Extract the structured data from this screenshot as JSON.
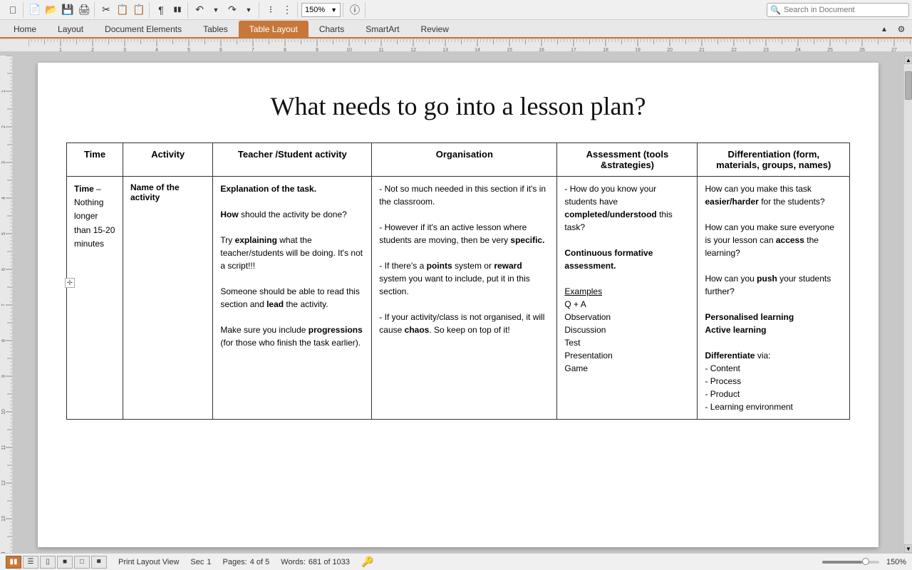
{
  "toolbar": {
    "zoom": "150%",
    "search_placeholder": "Search in Document"
  },
  "tabs": [
    {
      "id": "home",
      "label": "Home",
      "active": false
    },
    {
      "id": "layout",
      "label": "Layout",
      "active": false
    },
    {
      "id": "document-elements",
      "label": "Document Elements",
      "active": false
    },
    {
      "id": "tables",
      "label": "Tables",
      "active": false
    },
    {
      "id": "table-layout",
      "label": "Table Layout",
      "active": true
    },
    {
      "id": "charts",
      "label": "Charts",
      "active": false
    },
    {
      "id": "smartart",
      "label": "SmartArt",
      "active": false
    },
    {
      "id": "review",
      "label": "Review",
      "active": false
    }
  ],
  "document": {
    "title": "What needs to go into a lesson plan?",
    "table": {
      "headers": [
        {
          "id": "time",
          "label": "Time"
        },
        {
          "id": "activity",
          "label": "Activity"
        },
        {
          "id": "teacher",
          "label": "Teacher /Student activity"
        },
        {
          "id": "organisation",
          "label": "Organisation"
        },
        {
          "id": "assessment",
          "label": "Assessment (tools &strategies)"
        },
        {
          "id": "differentiation",
          "label": "Differentiation (form, materials, groups, names)"
        }
      ],
      "row": {
        "time": "Time – Nothing longer than 15-20 minutes",
        "activity_title": "Name of the activity",
        "teacher_content": [
          {
            "text": "Explanation of the task.",
            "bold": true
          },
          {
            "text": ""
          },
          {
            "text": "How",
            "bold": true,
            "inline": " should the activity be done?"
          },
          {
            "text": ""
          },
          {
            "text": "Try ",
            "bold": false,
            "inline_bold": "explaining",
            "inline_rest": " what the teacher/students will be doing. It's not a script!!!"
          },
          {
            "text": ""
          },
          {
            "text": "Someone should be able to read this section and ",
            "bold": false,
            "inline_bold": "lead",
            "inline_rest": " the activity."
          },
          {
            "text": ""
          },
          {
            "text": "Make sure you include ",
            "bold": false,
            "inline_bold": "progressions",
            "inline_rest": " (for those who finish the task earlier)."
          }
        ],
        "organisation_content": [
          "- Not so much needed in this section if it's in the classroom.",
          "",
          "- However if it's an active lesson where students are moving, then be very specific.",
          "",
          "- If there's a points system or reward system you want to include, put it in this section.",
          "",
          "- If your activity/class is not organised, it will cause chaos. So keep on top of it!"
        ],
        "assessment_content": {
          "intro": "- How do you know your students have completed/understood this task?",
          "formative": "Continuous formative assessment.",
          "examples_label": "Examples",
          "examples": [
            "Q + A",
            "Observation",
            "Discussion",
            "Test",
            "Presentation",
            "Game"
          ]
        },
        "diff_content": {
          "intro": "How can you make this task easier/harder for the students?",
          "q2": "How can you make sure everyone is your lesson can access the learning?",
          "q3": "How can you push your students further?",
          "personalised": "Personalised learning",
          "active": "Active learning",
          "diff_label": "Differentiate",
          "diff_via": "via:",
          "diff_items": [
            "- Content",
            "- Process",
            "- Product",
            "- Learning environment"
          ]
        }
      }
    }
  },
  "status": {
    "view_label": "Print Layout View",
    "sec_label": "Sec",
    "sec_val": "1",
    "pages_label": "Pages:",
    "pages_val": "4 of 5",
    "words_label": "Words:",
    "words_val": "681 of 1033",
    "zoom_val": "150%"
  }
}
